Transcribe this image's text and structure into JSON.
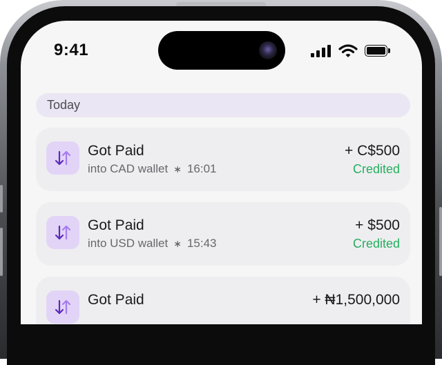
{
  "status_bar": {
    "time": "9:41",
    "icons": [
      "cellular-signal-icon",
      "wifi-icon",
      "battery-icon"
    ]
  },
  "section": {
    "label": "Today"
  },
  "colors": {
    "accent_purple": "#7b3fe4",
    "icon_bg": "#e2d4f7",
    "credited_green": "#27ae60",
    "section_bg": "#ebe6f3"
  },
  "transactions": [
    {
      "icon": "transfer-arrows-icon",
      "title": "Got Paid",
      "description": "into CAD wallet",
      "separator": "∗",
      "time": "16:01",
      "amount": "+ C$500",
      "status": "Credited"
    },
    {
      "icon": "transfer-arrows-icon",
      "title": "Got Paid",
      "description": "into USD wallet",
      "separator": "∗",
      "time": "15:43",
      "amount": "+ $500",
      "status": "Credited"
    },
    {
      "icon": "transfer-arrows-icon",
      "title": "Got Paid",
      "amount": "+ ₦1,500,000"
    }
  ]
}
